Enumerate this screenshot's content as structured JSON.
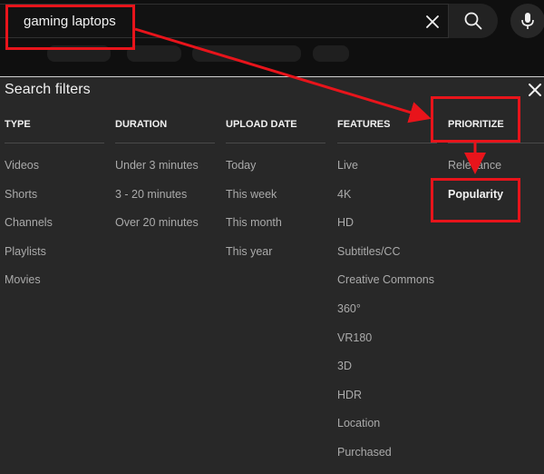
{
  "search": {
    "query": "gaming laptops"
  },
  "filters": {
    "title": "Search filters",
    "columns": [
      {
        "header": "TYPE",
        "items": [
          "Videos",
          "Shorts",
          "Channels",
          "Playlists",
          "Movies"
        ]
      },
      {
        "header": "DURATION",
        "items": [
          "Under 3 minutes",
          "3 - 20 minutes",
          "Over 20 minutes"
        ]
      },
      {
        "header": "UPLOAD DATE",
        "items": [
          "Today",
          "This week",
          "This month",
          "This year"
        ]
      },
      {
        "header": "FEATURES",
        "items": [
          "Live",
          "4K",
          "HD",
          "Subtitles/CC",
          "Creative Commons",
          "360°",
          "VR180",
          "3D",
          "HDR",
          "Location",
          "Purchased"
        ]
      },
      {
        "header": "PRIORITIZE",
        "items": [
          "Relevance",
          "Popularity"
        ],
        "selected": "Popularity"
      }
    ]
  },
  "icons": {
    "clear": "close-icon",
    "search": "search-icon",
    "mic": "microphone-icon",
    "panel_close": "close-icon"
  },
  "colors": {
    "annotation": "#e8141b",
    "panel_background": "#282828",
    "topbar_background": "#0f0f0f"
  }
}
